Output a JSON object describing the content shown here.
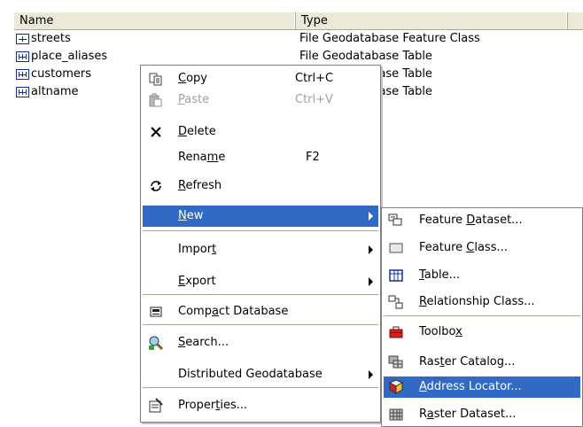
{
  "list": {
    "columns": {
      "name": "Name",
      "type": "Type"
    },
    "rows": [
      {
        "name": "streets",
        "type": "File Geodatabase Feature Class",
        "icon": "feature-class-icon"
      },
      {
        "name": "place_aliases",
        "type": "File Geodatabase Table",
        "icon": "table-icon"
      },
      {
        "name": "customers",
        "type": "File Geodatabase Table",
        "icon": "table-icon"
      },
      {
        "name": "altname",
        "type": "File Geodatabase Table",
        "icon": "table-icon"
      }
    ]
  },
  "context_menu": {
    "copy": {
      "pre": "",
      "acc": "C",
      "post": "opy",
      "shortcut": "Ctrl+C",
      "icon": "copy-icon"
    },
    "paste": {
      "pre": "",
      "acc": "P",
      "post": "aste",
      "shortcut": "Ctrl+V",
      "icon": "paste-icon"
    },
    "delete": {
      "pre": "",
      "acc": "D",
      "post": "elete",
      "icon": "delete-icon"
    },
    "rename": {
      "pre": "Rena",
      "acc": "m",
      "post": "e",
      "shortcut": "F2"
    },
    "refresh": {
      "pre": "",
      "acc": "R",
      "post": "efresh",
      "icon": "refresh-icon"
    },
    "new": {
      "pre": "",
      "acc": "N",
      "post": "ew"
    },
    "import": {
      "pre": "Impor",
      "acc": "t",
      "post": ""
    },
    "export": {
      "pre": "",
      "acc": "E",
      "post": "xport"
    },
    "compact": {
      "pre": "Comp",
      "acc": "a",
      "post": "ct Database",
      "icon": "compact-icon"
    },
    "search": {
      "pre": "",
      "acc": "S",
      "post": "earch...",
      "icon": "search-icon"
    },
    "distributed": {
      "pre": "Distributed Geodatabase",
      "acc": "",
      "post": ""
    },
    "properties": {
      "pre": "Proper",
      "acc": "t",
      "post": "ies...",
      "icon": "properties-icon"
    }
  },
  "new_submenu": {
    "feature_dataset": {
      "pre": "Feature ",
      "acc": "D",
      "post": "ataset..."
    },
    "feature_class": {
      "pre": "Feature ",
      "acc": "C",
      "post": "lass..."
    },
    "table": {
      "pre": "",
      "acc": "T",
      "post": "able..."
    },
    "relationship_class": {
      "pre": "",
      "acc": "R",
      "post": "elationship Class..."
    },
    "toolbox": {
      "pre": "Toolbo",
      "acc": "x",
      "post": ""
    },
    "raster_catalog": {
      "pre": "Ras",
      "acc": "t",
      "post": "er Catalog..."
    },
    "address_locator": {
      "pre": "",
      "acc": "A",
      "post": "ddress Locator..."
    },
    "raster_dataset": {
      "pre": "R",
      "acc": "a",
      "post": "ster Dataset..."
    }
  },
  "colors": {
    "highlight": "#316ac5",
    "disabled": "#a0a0a0"
  }
}
